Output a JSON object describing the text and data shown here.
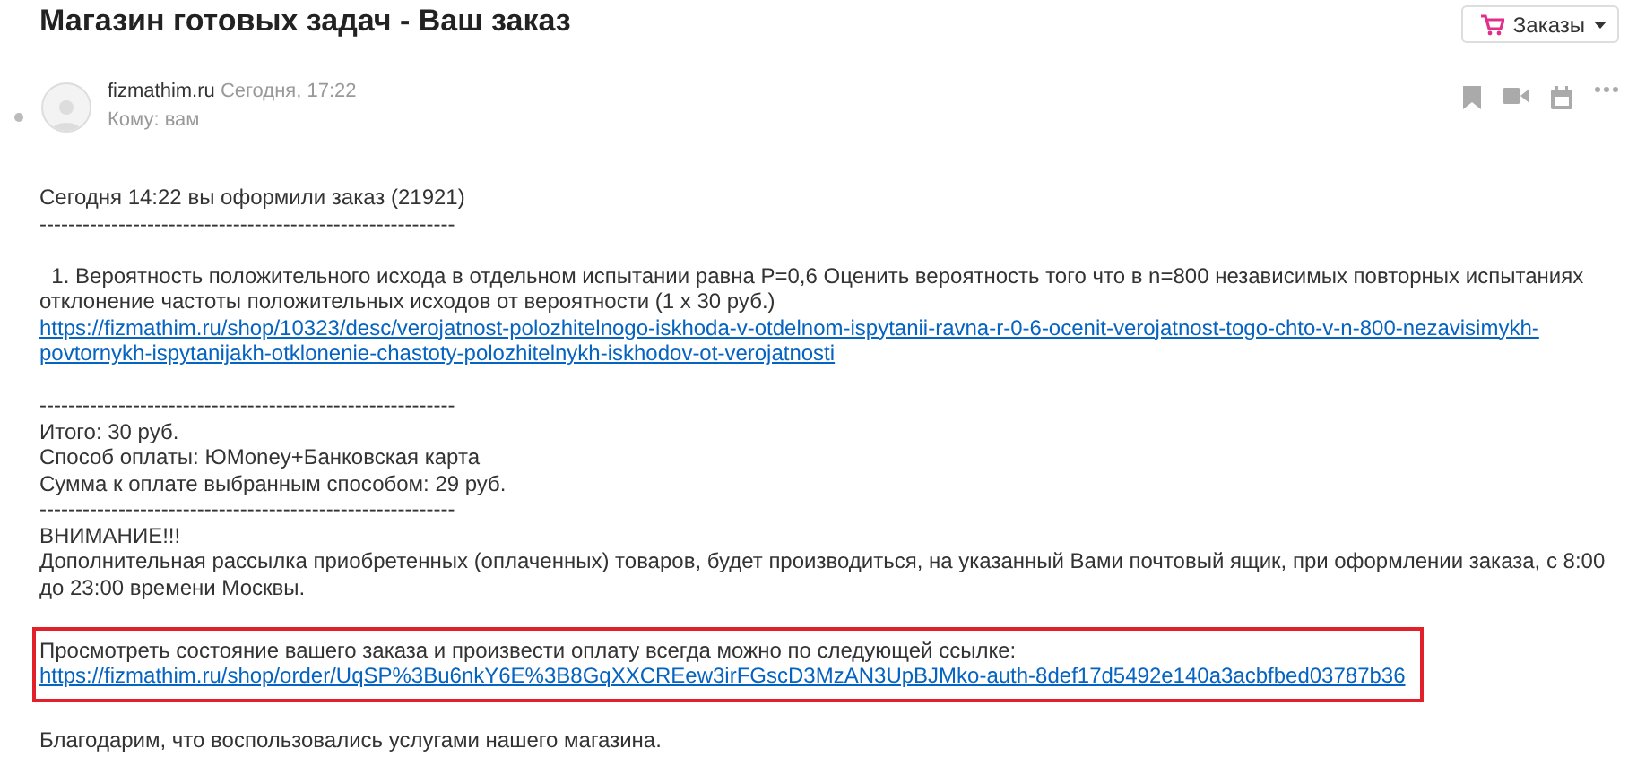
{
  "subject": "Магазин готовых задач - Ваш заказ",
  "folder_button": "Заказы",
  "sender": {
    "name": "fizmathim.ru",
    "time": "Сегодня, 17:22",
    "to": "Кому: вам"
  },
  "body": [
    {
      "kind": "text",
      "text": "Сегодня 14:22 вы оформили заказ (21921)"
    },
    {
      "kind": "text",
      "text": "----------------------------------------------------------"
    },
    {
      "kind": "gap"
    },
    {
      "kind": "text",
      "text": "  1. Вероятность положительного исхода в отдельном испытании равна P=0,6 Оценить вероятность того что в n=800 независимых повторных испытаниях отклонение частоты положительных исходов от вероятности (1 x 30 руб.)"
    },
    {
      "kind": "link",
      "text": "https://fizmathim.ru/shop/10323/desc/verojatnost-polozhitelnogo-iskhoda-v-otdelnom-ispytanii-ravna-r-0-6-ocenit-verojatnost-togo-chto-v-n-800-nezavisimykh-povtornykh-ispytanijakh-otklonenie-chastoty-polozhitelnykh-iskhodov-ot-verojatnosti"
    },
    {
      "kind": "gap"
    },
    {
      "kind": "text",
      "text": "----------------------------------------------------------"
    },
    {
      "kind": "text",
      "text": "Итого: 30 руб."
    },
    {
      "kind": "text",
      "text": "Способ оплаты: ЮMoney+Банковская карта"
    },
    {
      "kind": "text",
      "text": "Сумма к оплате выбранным способом: 29 руб."
    },
    {
      "kind": "text",
      "text": "----------------------------------------------------------"
    },
    {
      "kind": "text",
      "text": "ВНИМАНИЕ!!!"
    },
    {
      "kind": "text",
      "text": "Дополнительная рассылка приобретенных (оплаченных) товаров, будет производиться, на указанный Вами почтовый ящик, при оформлении заказа, с 8:00 до 23:00 времени Москвы."
    },
    {
      "kind": "gap"
    },
    {
      "kind": "highlight",
      "text": "Просмотреть состояние вашего заказа и произвести оплату всегда можно по следующей ссылке:",
      "link": "https://fizmathim.ru/shop/order/UqSP%3Bu6nkY6E%3B8GqXXCREew3irFGscD3MzAN3UpBJMko-auth-8def17d5492e140a3acbfbed03787b36"
    },
    {
      "kind": "gap"
    },
    {
      "kind": "text",
      "text": "Благодарим, что воспользовались услугами нашего магазина."
    }
  ]
}
